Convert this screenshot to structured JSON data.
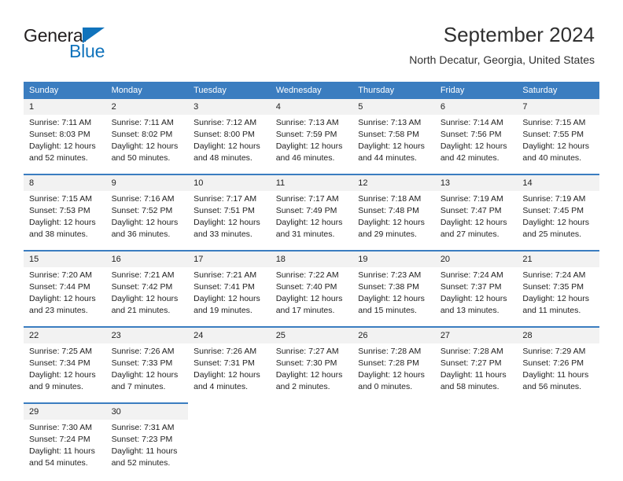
{
  "brand": {
    "name_part1": "General",
    "name_part2": "Blue",
    "accent_color": "#1073bc"
  },
  "header": {
    "title": "September 2024",
    "subtitle": "North Decatur, Georgia, United States"
  },
  "calendar": {
    "header_color": "#3b7dc0",
    "daynum_background": "#f2f2f2",
    "weekdays": [
      "Sunday",
      "Monday",
      "Tuesday",
      "Wednesday",
      "Thursday",
      "Friday",
      "Saturday"
    ],
    "weeks": [
      [
        {
          "day": "1",
          "sunrise": "Sunrise: 7:11 AM",
          "sunset": "Sunset: 8:03 PM",
          "daylight_line1": "Daylight: 12 hours",
          "daylight_line2": "and 52 minutes."
        },
        {
          "day": "2",
          "sunrise": "Sunrise: 7:11 AM",
          "sunset": "Sunset: 8:02 PM",
          "daylight_line1": "Daylight: 12 hours",
          "daylight_line2": "and 50 minutes."
        },
        {
          "day": "3",
          "sunrise": "Sunrise: 7:12 AM",
          "sunset": "Sunset: 8:00 PM",
          "daylight_line1": "Daylight: 12 hours",
          "daylight_line2": "and 48 minutes."
        },
        {
          "day": "4",
          "sunrise": "Sunrise: 7:13 AM",
          "sunset": "Sunset: 7:59 PM",
          "daylight_line1": "Daylight: 12 hours",
          "daylight_line2": "and 46 minutes."
        },
        {
          "day": "5",
          "sunrise": "Sunrise: 7:13 AM",
          "sunset": "Sunset: 7:58 PM",
          "daylight_line1": "Daylight: 12 hours",
          "daylight_line2": "and 44 minutes."
        },
        {
          "day": "6",
          "sunrise": "Sunrise: 7:14 AM",
          "sunset": "Sunset: 7:56 PM",
          "daylight_line1": "Daylight: 12 hours",
          "daylight_line2": "and 42 minutes."
        },
        {
          "day": "7",
          "sunrise": "Sunrise: 7:15 AM",
          "sunset": "Sunset: 7:55 PM",
          "daylight_line1": "Daylight: 12 hours",
          "daylight_line2": "and 40 minutes."
        }
      ],
      [
        {
          "day": "8",
          "sunrise": "Sunrise: 7:15 AM",
          "sunset": "Sunset: 7:53 PM",
          "daylight_line1": "Daylight: 12 hours",
          "daylight_line2": "and 38 minutes."
        },
        {
          "day": "9",
          "sunrise": "Sunrise: 7:16 AM",
          "sunset": "Sunset: 7:52 PM",
          "daylight_line1": "Daylight: 12 hours",
          "daylight_line2": "and 36 minutes."
        },
        {
          "day": "10",
          "sunrise": "Sunrise: 7:17 AM",
          "sunset": "Sunset: 7:51 PM",
          "daylight_line1": "Daylight: 12 hours",
          "daylight_line2": "and 33 minutes."
        },
        {
          "day": "11",
          "sunrise": "Sunrise: 7:17 AM",
          "sunset": "Sunset: 7:49 PM",
          "daylight_line1": "Daylight: 12 hours",
          "daylight_line2": "and 31 minutes."
        },
        {
          "day": "12",
          "sunrise": "Sunrise: 7:18 AM",
          "sunset": "Sunset: 7:48 PM",
          "daylight_line1": "Daylight: 12 hours",
          "daylight_line2": "and 29 minutes."
        },
        {
          "day": "13",
          "sunrise": "Sunrise: 7:19 AM",
          "sunset": "Sunset: 7:47 PM",
          "daylight_line1": "Daylight: 12 hours",
          "daylight_line2": "and 27 minutes."
        },
        {
          "day": "14",
          "sunrise": "Sunrise: 7:19 AM",
          "sunset": "Sunset: 7:45 PM",
          "daylight_line1": "Daylight: 12 hours",
          "daylight_line2": "and 25 minutes."
        }
      ],
      [
        {
          "day": "15",
          "sunrise": "Sunrise: 7:20 AM",
          "sunset": "Sunset: 7:44 PM",
          "daylight_line1": "Daylight: 12 hours",
          "daylight_line2": "and 23 minutes."
        },
        {
          "day": "16",
          "sunrise": "Sunrise: 7:21 AM",
          "sunset": "Sunset: 7:42 PM",
          "daylight_line1": "Daylight: 12 hours",
          "daylight_line2": "and 21 minutes."
        },
        {
          "day": "17",
          "sunrise": "Sunrise: 7:21 AM",
          "sunset": "Sunset: 7:41 PM",
          "daylight_line1": "Daylight: 12 hours",
          "daylight_line2": "and 19 minutes."
        },
        {
          "day": "18",
          "sunrise": "Sunrise: 7:22 AM",
          "sunset": "Sunset: 7:40 PM",
          "daylight_line1": "Daylight: 12 hours",
          "daylight_line2": "and 17 minutes."
        },
        {
          "day": "19",
          "sunrise": "Sunrise: 7:23 AM",
          "sunset": "Sunset: 7:38 PM",
          "daylight_line1": "Daylight: 12 hours",
          "daylight_line2": "and 15 minutes."
        },
        {
          "day": "20",
          "sunrise": "Sunrise: 7:24 AM",
          "sunset": "Sunset: 7:37 PM",
          "daylight_line1": "Daylight: 12 hours",
          "daylight_line2": "and 13 minutes."
        },
        {
          "day": "21",
          "sunrise": "Sunrise: 7:24 AM",
          "sunset": "Sunset: 7:35 PM",
          "daylight_line1": "Daylight: 12 hours",
          "daylight_line2": "and 11 minutes."
        }
      ],
      [
        {
          "day": "22",
          "sunrise": "Sunrise: 7:25 AM",
          "sunset": "Sunset: 7:34 PM",
          "daylight_line1": "Daylight: 12 hours",
          "daylight_line2": "and 9 minutes."
        },
        {
          "day": "23",
          "sunrise": "Sunrise: 7:26 AM",
          "sunset": "Sunset: 7:33 PM",
          "daylight_line1": "Daylight: 12 hours",
          "daylight_line2": "and 7 minutes."
        },
        {
          "day": "24",
          "sunrise": "Sunrise: 7:26 AM",
          "sunset": "Sunset: 7:31 PM",
          "daylight_line1": "Daylight: 12 hours",
          "daylight_line2": "and 4 minutes."
        },
        {
          "day": "25",
          "sunrise": "Sunrise: 7:27 AM",
          "sunset": "Sunset: 7:30 PM",
          "daylight_line1": "Daylight: 12 hours",
          "daylight_line2": "and 2 minutes."
        },
        {
          "day": "26",
          "sunrise": "Sunrise: 7:28 AM",
          "sunset": "Sunset: 7:28 PM",
          "daylight_line1": "Daylight: 12 hours",
          "daylight_line2": "and 0 minutes."
        },
        {
          "day": "27",
          "sunrise": "Sunrise: 7:28 AM",
          "sunset": "Sunset: 7:27 PM",
          "daylight_line1": "Daylight: 11 hours",
          "daylight_line2": "and 58 minutes."
        },
        {
          "day": "28",
          "sunrise": "Sunrise: 7:29 AM",
          "sunset": "Sunset: 7:26 PM",
          "daylight_line1": "Daylight: 11 hours",
          "daylight_line2": "and 56 minutes."
        }
      ],
      [
        {
          "day": "29",
          "sunrise": "Sunrise: 7:30 AM",
          "sunset": "Sunset: 7:24 PM",
          "daylight_line1": "Daylight: 11 hours",
          "daylight_line2": "and 54 minutes."
        },
        {
          "day": "30",
          "sunrise": "Sunrise: 7:31 AM",
          "sunset": "Sunset: 7:23 PM",
          "daylight_line1": "Daylight: 11 hours",
          "daylight_line2": "and 52 minutes."
        },
        {
          "day": "",
          "sunrise": "",
          "sunset": "",
          "daylight_line1": "",
          "daylight_line2": ""
        },
        {
          "day": "",
          "sunrise": "",
          "sunset": "",
          "daylight_line1": "",
          "daylight_line2": ""
        },
        {
          "day": "",
          "sunrise": "",
          "sunset": "",
          "daylight_line1": "",
          "daylight_line2": ""
        },
        {
          "day": "",
          "sunrise": "",
          "sunset": "",
          "daylight_line1": "",
          "daylight_line2": ""
        },
        {
          "day": "",
          "sunrise": "",
          "sunset": "",
          "daylight_line1": "",
          "daylight_line2": ""
        }
      ]
    ]
  }
}
